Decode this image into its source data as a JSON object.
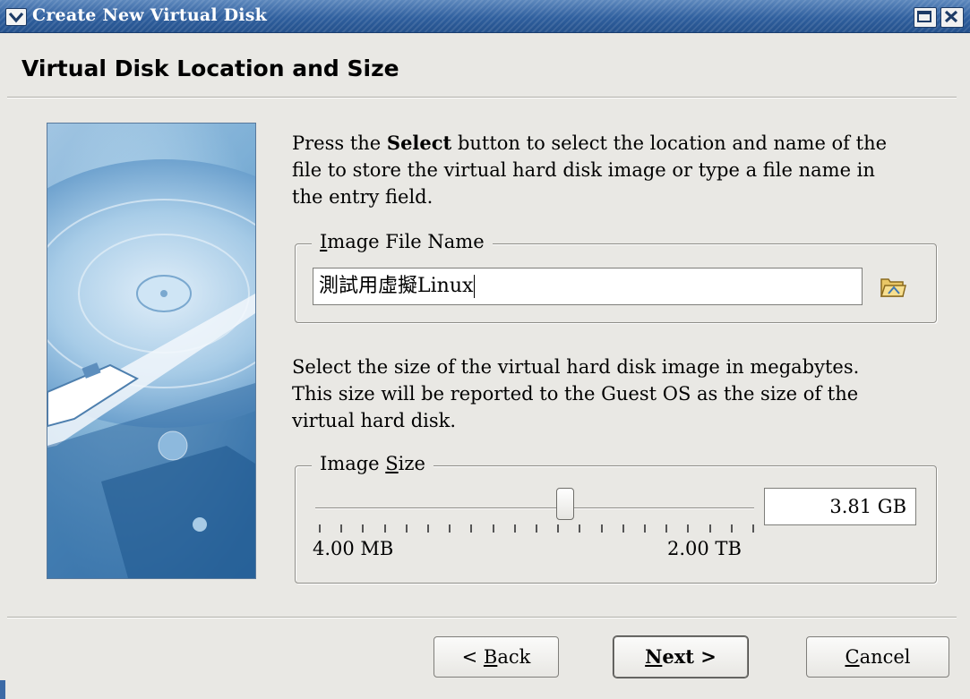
{
  "window": {
    "title": "Create New Virtual Disk"
  },
  "page": {
    "heading": "Virtual Disk Location and Size"
  },
  "location": {
    "description_before": "Press the ",
    "description_bold": "Select",
    "description_line1_after": " button to select the location and name of the",
    "description_line2": "file to store the virtual hard disk image or type a file name in",
    "description_line3": "the entry field.",
    "group_label_mnemonic": "I",
    "group_label_rest": "mage File Name",
    "file_name_value": "測試用虛擬Linux"
  },
  "size": {
    "description_line1": "Select the size of the virtual hard disk image in megabytes.",
    "description_line2": "This size will be reported to the Guest OS as the size of the",
    "description_line3": "virtual hard disk.",
    "group_label_before": "Image ",
    "group_label_mnemonic": "S",
    "group_label_rest": "ize",
    "min_label": "4.00 MB",
    "max_label": "2.00 TB",
    "value": "3.81 GB",
    "slider_fraction": 0.57
  },
  "buttons": {
    "back_prefix": "< ",
    "back_mnemonic": "B",
    "back_rest": "ack",
    "next_mnemonic": "N",
    "next_rest": "ext",
    "next_suffix": " >",
    "cancel_mnemonic": "C",
    "cancel_rest": "ancel"
  },
  "icons": {
    "window_menu": "chevron-down-icon",
    "maximize": "maximize-icon",
    "close": "close-icon",
    "folder": "folder-open-icon"
  },
  "colors": {
    "titlebar": "#2f5f9e",
    "window_background": "#e9e8e4"
  }
}
